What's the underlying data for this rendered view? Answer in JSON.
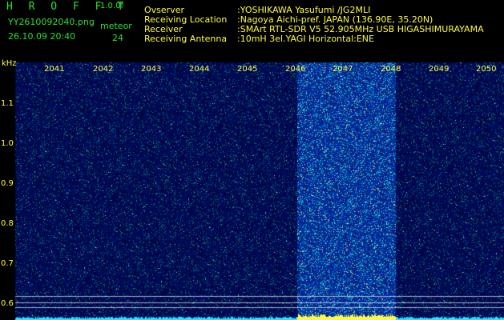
{
  "app": {
    "title": "H R O F F T",
    "version": "1.0.0f"
  },
  "file": {
    "name": "YY2610092040.png",
    "datetime": "26.10.09 20:40"
  },
  "meteor": {
    "label": "meteor",
    "count": "24"
  },
  "info": [
    {
      "label": "Ovserver",
      "value": ":YOSHIKAWA Yasufumi /JG2MLI"
    },
    {
      "label": "Receiving Location",
      "value": ":Nagoya Aichi-pref. JAPAN (136.90E, 35.20N)"
    },
    {
      "label": "Receiver",
      "value": ":SMArt RTL-SDR V5 52.905MHz USB HIGASHIMURAYAMA"
    },
    {
      "label": "Receiving Antenna",
      "value": ":10mH 3el.YAGI Horizontal:ENE"
    }
  ],
  "axis": {
    "y_unit": "kHz",
    "y_ticks": [
      "1.1",
      "1.0",
      "0.9",
      "0.8",
      "0.7",
      "0.6"
    ],
    "x_ticks": [
      "2041",
      "2042",
      "2043",
      "2044",
      "2045",
      "2046",
      "2047",
      "2048",
      "2049",
      "2050"
    ]
  },
  "colors": {
    "background": "#000000",
    "noise": "#0a1a9a",
    "signal": "#ffff00",
    "grid": "#ffffff"
  }
}
